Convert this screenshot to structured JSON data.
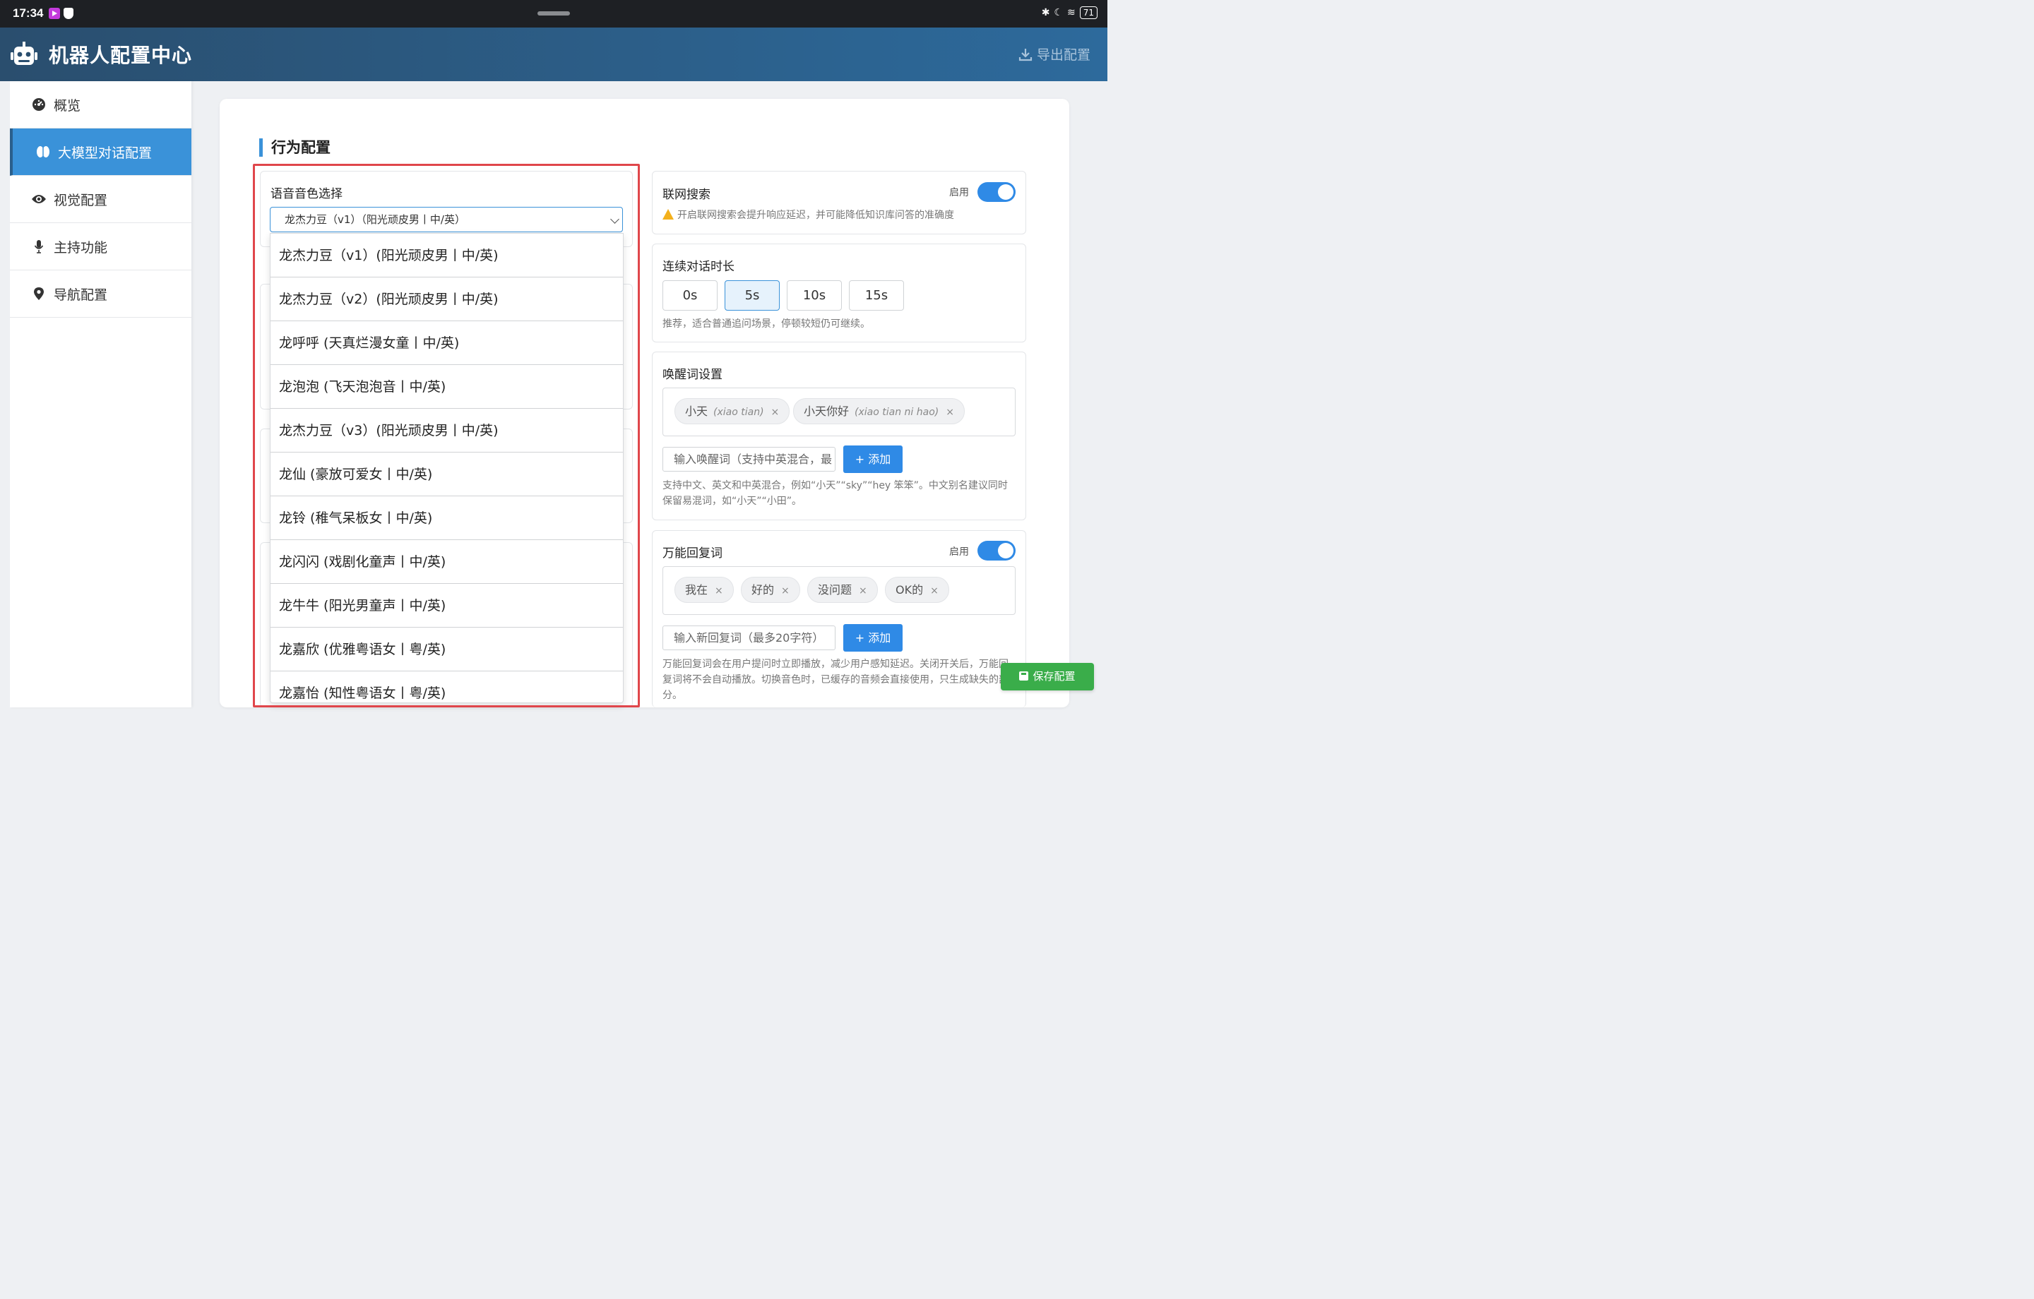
{
  "status_bar": {
    "time": "17:34",
    "battery": "71"
  },
  "header": {
    "title": "机器人配置中心",
    "export_label": "导出配置"
  },
  "sidebar": {
    "items": [
      {
        "label": "概览",
        "icon": "dashboard-icon"
      },
      {
        "label": "大模型对话配置",
        "icon": "brain-icon",
        "active": true
      },
      {
        "label": "视觉配置",
        "icon": "eye-icon"
      },
      {
        "label": "主持功能",
        "icon": "microphone-icon"
      },
      {
        "label": "导航配置",
        "icon": "map-pin-icon"
      }
    ]
  },
  "main": {
    "section_title": "行为配置",
    "voice": {
      "label": "语音音色选择",
      "selected": "龙杰力豆（v1）（阳光顽皮男丨中/英）",
      "options": [
        "龙杰力豆（v1）(阳光顽皮男丨中/英)",
        "龙杰力豆（v2）(阳光顽皮男丨中/英)",
        "龙呼呼 (天真烂漫女童丨中/英)",
        "龙泡泡 (飞天泡泡音丨中/英)",
        "龙杰力豆（v3）(阳光顽皮男丨中/英)",
        "龙仙 (豪放可爱女丨中/英)",
        "龙铃 (稚气呆板女丨中/英)",
        "龙闪闪 (戏剧化童声丨中/英)",
        "龙牛牛 (阳光男童声丨中/英)",
        "龙嘉欣 (优雅粤语女丨粤/英)",
        "龙嘉怡 (知性粤语女丨粤/英)"
      ]
    },
    "web_search": {
      "title": "联网搜索",
      "toggle_label": "启用",
      "enabled": true,
      "warning": "开启联网搜索会提升响应延迟，并可能降低知识库问答的准确度"
    },
    "duration": {
      "title": "连续对话时长",
      "options": [
        "0s",
        "5s",
        "10s",
        "15s"
      ],
      "selected": "5s",
      "hint": "推荐，适合普通追问场景，停顿较短仍可继续。"
    },
    "wake_words": {
      "title": "唤醒词设置",
      "tags": [
        {
          "word": "小天",
          "pinyin": "(xiao tian)"
        },
        {
          "word": "小天你好",
          "pinyin": "(xiao tian ni hao)"
        }
      ],
      "input_placeholder": "输入唤醒词（支持中英混合，最",
      "add_label": "添加",
      "hint": "支持中文、英文和中英混合，例如“小天”“sky”“hey 笨笨”。中文别名建议同时保留易混词，如“小天”“小田”。"
    },
    "universal_reply": {
      "title": "万能回复词",
      "toggle_label": "启用",
      "enabled": true,
      "tags": [
        "我在",
        "好的",
        "没问题",
        "OK的"
      ],
      "input_placeholder": "输入新回复词（最多20字符）",
      "add_label": "添加",
      "hint": "万能回复词会在用户提问时立即播放，减少用户感知延迟。关闭开关后，万能回复词将不会自动播放。切换音色时，已缓存的音频会直接使用，只生成缺失的部分。"
    },
    "save_label": "保存配置"
  },
  "colors": {
    "accent": "#3a92d9",
    "header_bg": "#2a4e6e",
    "save": "#3aad4a",
    "highlight_outline": "#e0464b"
  }
}
